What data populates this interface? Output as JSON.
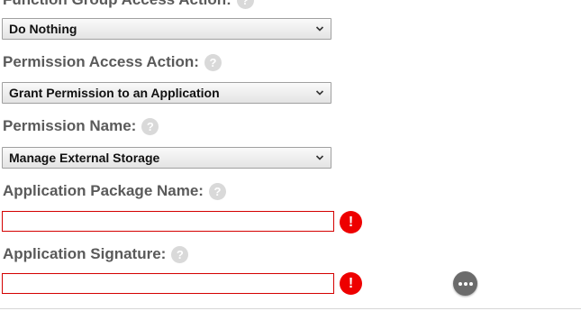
{
  "function_group": {
    "label": "Function Group Access Action:",
    "help_icon": "?",
    "select_value": "Do Nothing"
  },
  "permission_access": {
    "label": "Permission Access Action:",
    "help_icon": "?",
    "select_value": "Grant Permission to an Application"
  },
  "permission_name": {
    "label": "Permission Name:",
    "help_icon": "?",
    "select_value": "Manage External Storage"
  },
  "package_name": {
    "label": "Application Package Name:",
    "help_icon": "?",
    "value": "",
    "error_icon": "!"
  },
  "signature": {
    "label": "Application Signature:",
    "help_icon": "?",
    "value": "",
    "error_icon": "!"
  },
  "icons": {
    "help": "question-circle-icon",
    "error": "exclamation-circle-icon",
    "more": "more-options-icon",
    "chevron": "chevron-down-icon"
  },
  "colors": {
    "error_red": "#ee0000",
    "input_border_error": "#d40000",
    "label_text": "#5a5a5a",
    "help_grey": "#d9d9d9"
  }
}
